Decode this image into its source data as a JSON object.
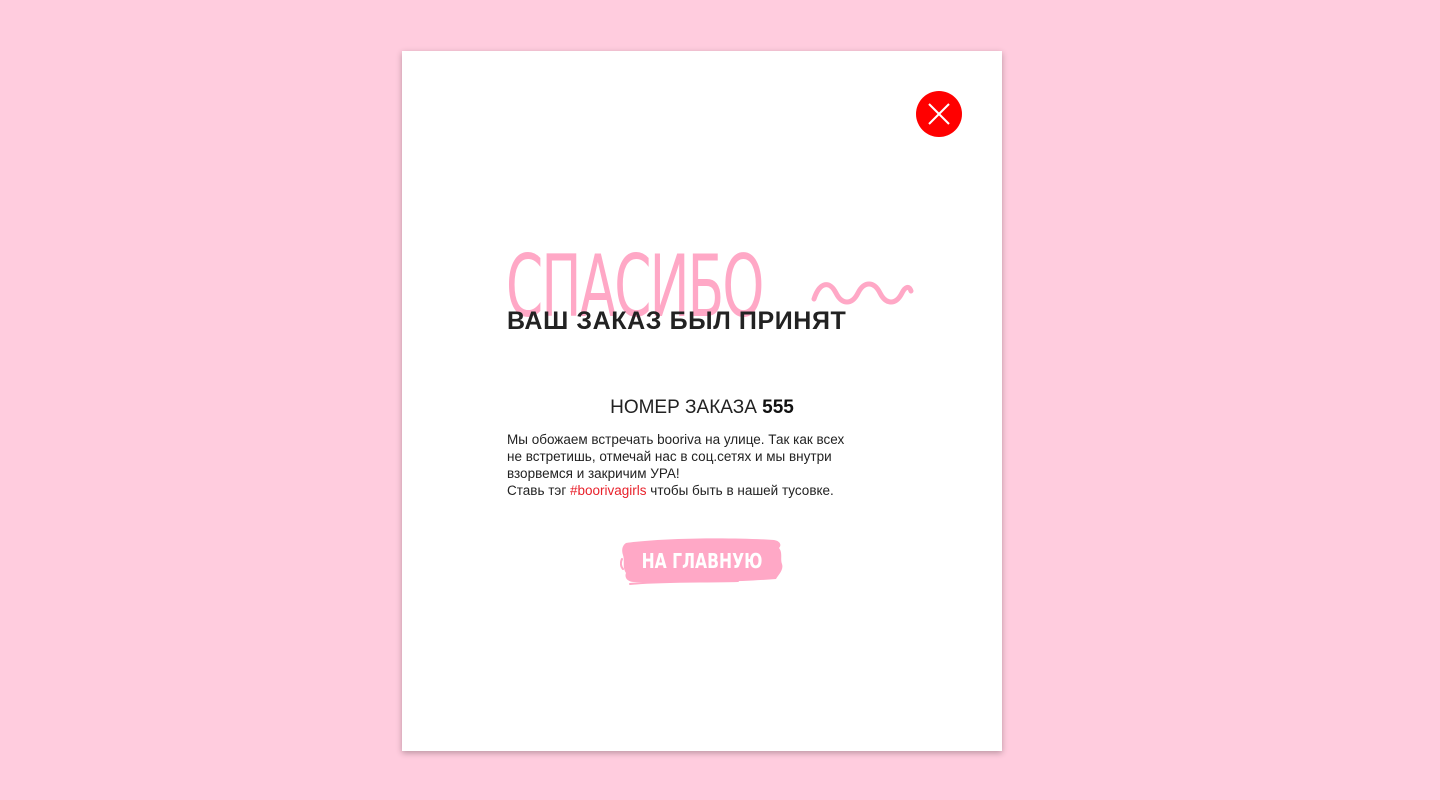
{
  "modal": {
    "close_icon": "close-icon",
    "thanks_heading": "СПАСИБО",
    "subtitle": "ВАШ ЗАКАЗ БЫЛ ПРИНЯТ",
    "order_label": "НОМЕР ЗАКАЗА",
    "order_number": "555",
    "message": {
      "line1": "Мы обожаем встречать booriva на улице.  Так как всех",
      "line2": "не встретишь, отмечай нас в соц.сетях  и мы внутри",
      "line3": "взорвемся и закричим УРА!",
      "line4_start": "Ставь тэг ",
      "hashtag": "#boorivagirls",
      "line4_end": " чтобы быть в нашей тусовке."
    },
    "home_button_label": "НА ГЛАВНУЮ"
  },
  "colors": {
    "background": "#ffccde",
    "accent_pink": "#ffa8c6",
    "close_red": "#ff0000",
    "hashtag_red": "#e8212b"
  }
}
